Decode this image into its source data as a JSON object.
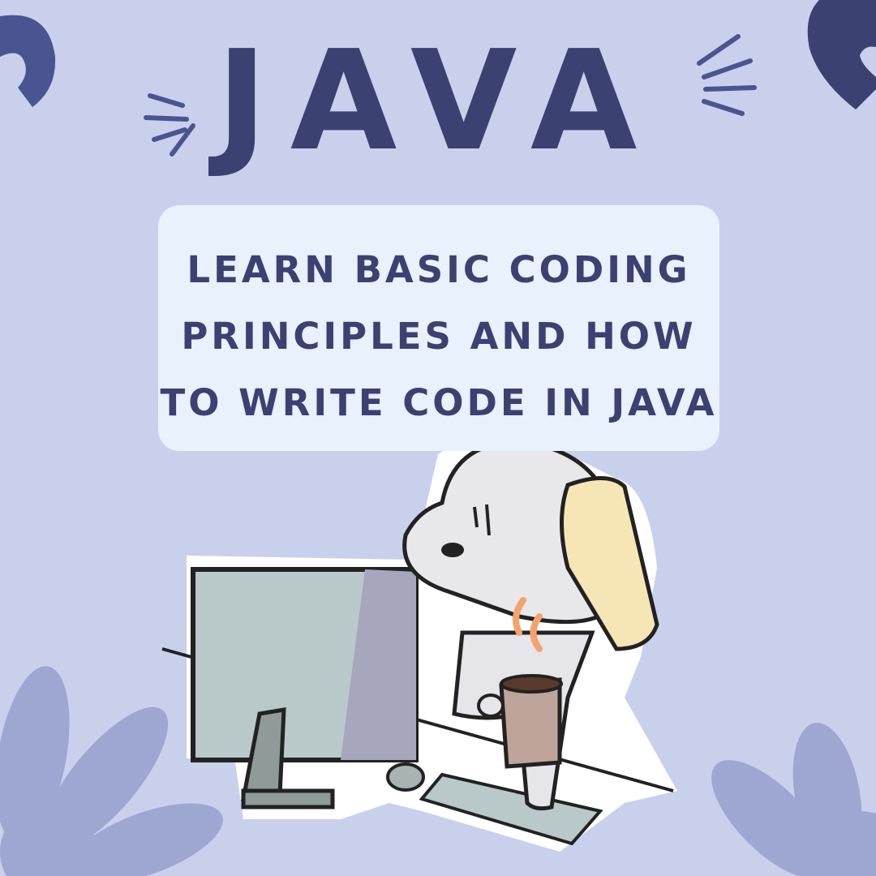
{
  "title": "JAVA",
  "subtitle_lines": [
    "LEARN BASIC CODING",
    "PRINCIPLES AND HOW",
    "TO WRITE CODE IN JAVA"
  ],
  "colors": {
    "background": "#c9d0ec",
    "text": "#3b4170",
    "box": "#e8f1fc",
    "accent": "#4a5490"
  }
}
